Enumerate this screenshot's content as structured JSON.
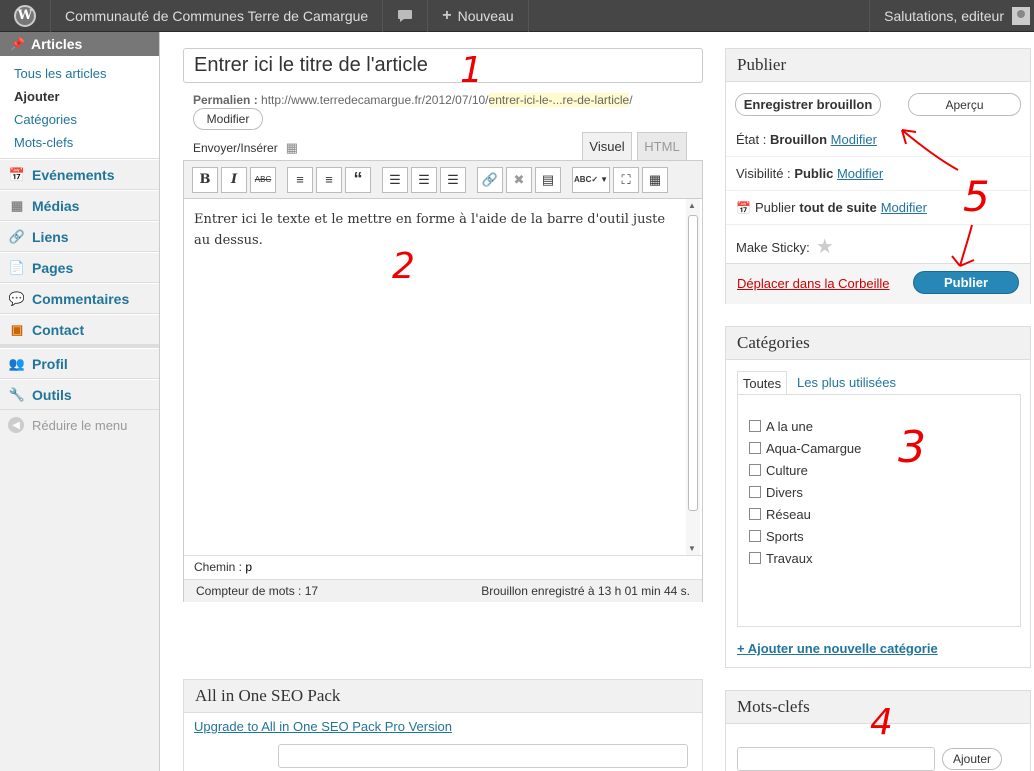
{
  "adminbar": {
    "logo": "W",
    "site_name": "Communauté de Communes Terre de Camargue",
    "new_label": "Nouveau",
    "greeting": "Salutations, editeur"
  },
  "sidebar": {
    "current_menu": "Articles",
    "submenu": [
      "Tous les articles",
      "Ajouter",
      "Catégories",
      "Mots-clefs"
    ],
    "items": [
      "Evénements",
      "Médias",
      "Liens",
      "Pages",
      "Commentaires",
      "Contact",
      "Profil",
      "Outils"
    ],
    "collapse": "Réduire le menu"
  },
  "editor": {
    "title": "Entrer ici le titre de l'article",
    "permalink_label": "Permalien :",
    "permalink_base": "http://www.terredecamargue.fr/2012/07/10/",
    "permalink_slug": "entrer-ici-le-...re-de-larticle",
    "permalink_end": "/",
    "modify": "Modifier",
    "upload_label": "Envoyer/Insérer",
    "tab_visual": "Visuel",
    "tab_html": "HTML",
    "content": "Entrer ici le texte et le mettre en forme à l'aide de la barre d'outil juste au dessus.",
    "path_label": "Chemin :",
    "path_value": "p",
    "word_count": "Compteur de mots : 17",
    "draft_saved": "Brouillon enregistré à 13 h 01 min 44 s."
  },
  "seo": {
    "title": "All in One SEO Pack",
    "upgrade": "Upgrade to All in One SEO Pack Pro Version"
  },
  "publish": {
    "title": "Publier",
    "save_draft": "Enregistrer brouillon",
    "preview": "Aperçu",
    "status_label": "État :",
    "status_value": "Brouillon",
    "visibility_label": "Visibilité :",
    "visibility_value": "Public",
    "publish_label": "Publier",
    "publish_value": "tout de suite",
    "modify": "Modifier",
    "sticky": "Make Sticky:",
    "trash": "Déplacer dans la Corbeille",
    "publish_btn": "Publier"
  },
  "categories": {
    "title": "Catégories",
    "tab_all": "Toutes",
    "tab_popular": "Les plus utilisées",
    "items": [
      "A la une",
      "Aqua-Camargue",
      "Culture",
      "Divers",
      "Réseau",
      "Sports",
      "Travaux"
    ],
    "add": "+ Ajouter une nouvelle catégorie"
  },
  "tags": {
    "title": "Mots-clefs",
    "add": "Ajouter"
  },
  "annotations": [
    "1",
    "2",
    "3",
    "4",
    "5"
  ]
}
